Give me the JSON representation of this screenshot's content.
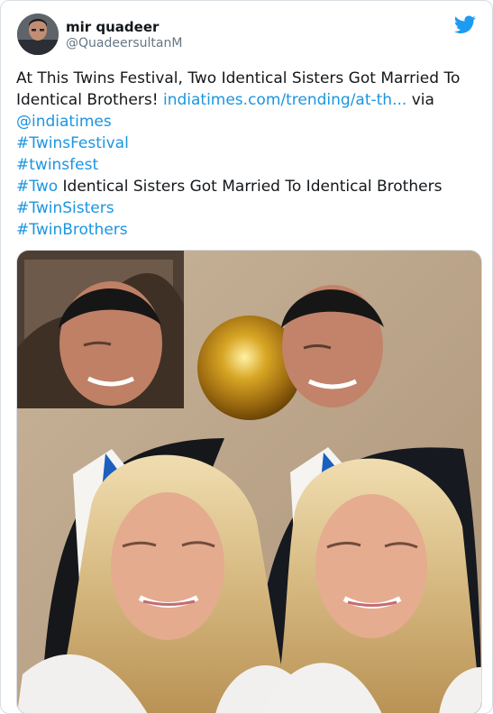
{
  "tweet": {
    "author": {
      "display_name": "mir quadeer",
      "handle": "@QuadeersultanM"
    },
    "text": {
      "line1": "At This Twins Festival, Two Identical Sisters Got Married To",
      "line2_start": "Identical Brothers! ",
      "line2_link": "indiatimes.com/trending/at-th...",
      "line2_end": " via",
      "line3_mention": "@indiatimes",
      "line4_hashtag": "#TwinsFestival",
      "line5_hashtag": "#twinsfest",
      "line6_hashtag": "#Two",
      "line6_text": " Identical Sisters Got Married To Identical Brothers",
      "line7_hashtag": "#TwinSisters",
      "line8_hashtag": "#TwinBrothers"
    },
    "icons": {
      "avatar": "avatar",
      "platform": "twitter-bird-icon",
      "media": "photo-icon"
    },
    "colors": {
      "accent": "#1b95e0",
      "text": "#14171a",
      "muted": "#657786",
      "border": "#d7dde2"
    }
  }
}
